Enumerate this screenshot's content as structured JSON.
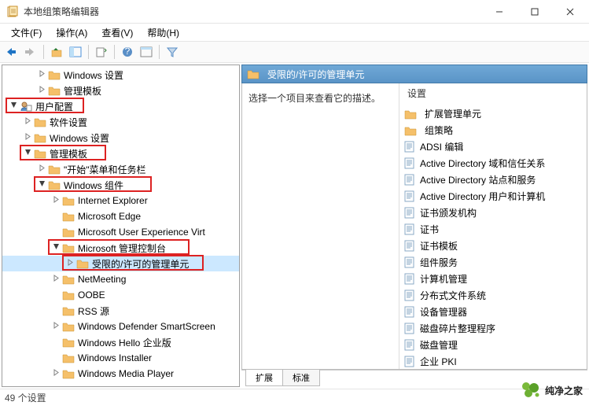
{
  "window": {
    "title": "本地组策略编辑器"
  },
  "menu": {
    "file": "文件(F)",
    "action": "操作(A)",
    "view": "查看(V)",
    "help": "帮助(H)"
  },
  "tree": {
    "items": [
      {
        "indent": 2,
        "exp": ">",
        "label": "Windows 设置"
      },
      {
        "indent": 2,
        "exp": ">",
        "label": "管理模板"
      },
      {
        "indent": 0,
        "exp": "v",
        "label": "用户配置",
        "icon": "user",
        "hl": true
      },
      {
        "indent": 1,
        "exp": ">",
        "label": "软件设置"
      },
      {
        "indent": 1,
        "exp": ">",
        "label": "Windows 设置"
      },
      {
        "indent": 1,
        "exp": "v",
        "label": "管理模板",
        "hl": true
      },
      {
        "indent": 2,
        "exp": ">",
        "label": "\"开始\"菜单和任务栏"
      },
      {
        "indent": 2,
        "exp": "v",
        "label": "Windows 组件",
        "hl": true
      },
      {
        "indent": 3,
        "exp": ">",
        "label": "Internet Explorer"
      },
      {
        "indent": 3,
        "exp": "",
        "label": "Microsoft Edge"
      },
      {
        "indent": 3,
        "exp": "",
        "label": "Microsoft User Experience Virt"
      },
      {
        "indent": 3,
        "exp": "v",
        "label": "Microsoft 管理控制台",
        "hl": true
      },
      {
        "indent": 4,
        "exp": ">",
        "label": "受限的/许可的管理单元",
        "sel": true,
        "hl": true
      },
      {
        "indent": 3,
        "exp": ">",
        "label": "NetMeeting"
      },
      {
        "indent": 3,
        "exp": "",
        "label": "OOBE"
      },
      {
        "indent": 3,
        "exp": "",
        "label": "RSS 源"
      },
      {
        "indent": 3,
        "exp": ">",
        "label": "Windows Defender SmartScreen"
      },
      {
        "indent": 3,
        "exp": "",
        "label": "Windows Hello 企业版"
      },
      {
        "indent": 3,
        "exp": "",
        "label": "Windows Installer"
      },
      {
        "indent": 3,
        "exp": ">",
        "label": "Windows Media Player"
      }
    ]
  },
  "right": {
    "header": "受限的/许可的管理单元",
    "desc": "选择一个项目来查看它的描述。",
    "list_header": "设置",
    "items": [
      {
        "icon": "folder",
        "label": "扩展管理单元"
      },
      {
        "icon": "folder",
        "label": "组策略"
      },
      {
        "icon": "setting",
        "label": "ADSI 编辑"
      },
      {
        "icon": "setting",
        "label": "Active Directory 域和信任关系"
      },
      {
        "icon": "setting",
        "label": "Active Directory 站点和服务"
      },
      {
        "icon": "setting",
        "label": "Active Directory 用户和计算机"
      },
      {
        "icon": "setting",
        "label": "证书颁发机构"
      },
      {
        "icon": "setting",
        "label": "证书"
      },
      {
        "icon": "setting",
        "label": "证书模板"
      },
      {
        "icon": "setting",
        "label": "组件服务"
      },
      {
        "icon": "setting",
        "label": "计算机管理"
      },
      {
        "icon": "setting",
        "label": "分布式文件系统"
      },
      {
        "icon": "setting",
        "label": "设备管理器"
      },
      {
        "icon": "setting",
        "label": "磁盘碎片整理程序"
      },
      {
        "icon": "setting",
        "label": "磁盘管理"
      },
      {
        "icon": "setting",
        "label": "企业 PKI"
      }
    ],
    "tabs": {
      "extended": "扩展",
      "standard": "标准"
    }
  },
  "status": {
    "text": "49 个设置"
  },
  "watermark": {
    "text": "纯净之家"
  }
}
